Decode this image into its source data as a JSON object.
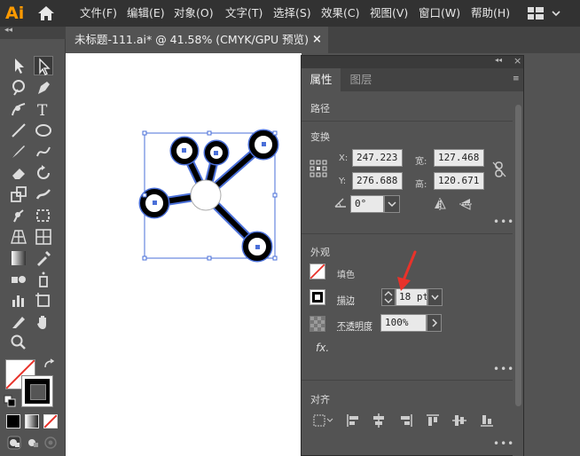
{
  "app": {
    "logo": "Ai"
  },
  "menu": [
    "文件(F)",
    "编辑(E)",
    "对象(O)",
    "文字(T)",
    "选择(S)",
    "效果(C)",
    "视图(V)",
    "窗口(W)",
    "帮助(H)"
  ],
  "doc_tab": {
    "title": "未标题-111.ai* @ 41.58% (CMYK/GPU 预览)",
    "close": "×"
  },
  "panel": {
    "tabs": [
      "属性",
      "图层"
    ],
    "path_label": "路径",
    "transform": {
      "title": "变换",
      "x_label": "X:",
      "x": "247.223",
      "y_label": "Y:",
      "y": "276.688",
      "w_label": "宽:",
      "w": "127.468",
      "h_label": "高:",
      "h": "120.671",
      "angle": "0°"
    },
    "appearance": {
      "title": "外观",
      "fill_label": "填色",
      "stroke_label": "描边",
      "stroke_value": "18 pt",
      "opacity_label": "不透明度",
      "opacity_value": "100%",
      "fx": "fx."
    },
    "align": {
      "title": "对齐"
    },
    "more": "•••"
  },
  "colors": {
    "accent_logo": "#ff9a00",
    "selection": "#4a6fd8",
    "annotation_arrow": "#e8322a",
    "stroke": "#000000"
  }
}
